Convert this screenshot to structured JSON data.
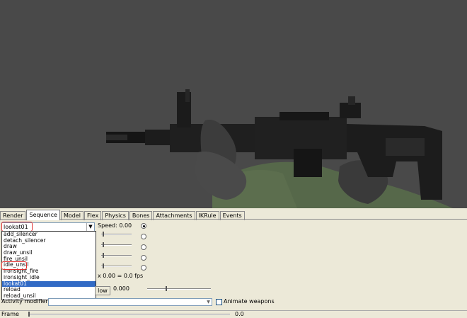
{
  "tabs": [
    "Render",
    "Sequence",
    "Model",
    "Flex",
    "Physics",
    "Bones",
    "Attachments",
    "IKRule",
    "Events"
  ],
  "active_tab": "Sequence",
  "sequence": {
    "selected": "lookat01",
    "speed_label": "Speed: 0.00",
    "fps_label": "x 0.00 = 0.0 fps",
    "blend_button": "low",
    "blend_value": "0.000",
    "activity_label": "Activity modifiers:",
    "animate_label": "Animate weapons",
    "options": [
      "add_silencer",
      "detach_silencer",
      "draw",
      "draw_unsil",
      "fire_unsil",
      "idle_unsil",
      "ironsight_fire",
      "ironsight_idle",
      "lookat01",
      "reload",
      "reload_unsil"
    ],
    "highlighted_option": "idle_unsil"
  },
  "frame": {
    "label": "Frame",
    "value": "0.0"
  },
  "colors": {
    "viewport_bg": "#494949",
    "panel_bg": "#ece9d8",
    "selection": "#316ac5",
    "highlight_ring": "#e23030"
  }
}
